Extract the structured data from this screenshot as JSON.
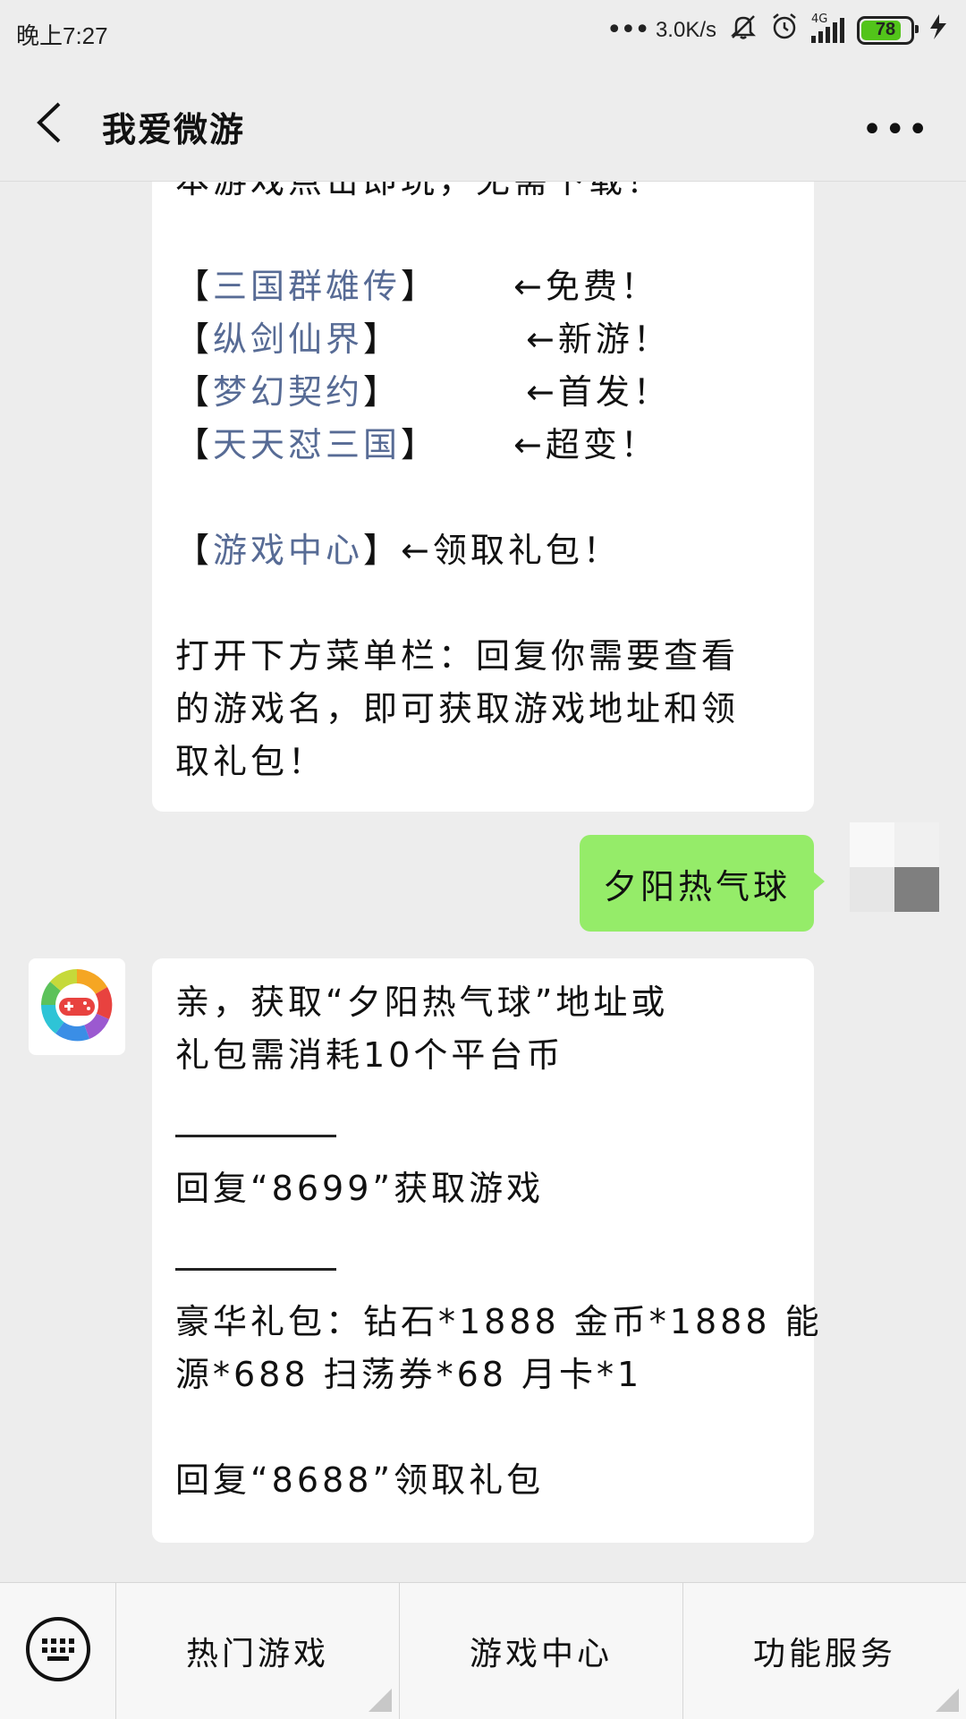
{
  "status_bar": {
    "time": "晚上7:27",
    "net_speed": "3.0K/s",
    "network_type": "4G",
    "battery_level": "78"
  },
  "header": {
    "title": "我爱微游"
  },
  "messages": {
    "first": {
      "cut_line": "本游戏点击即玩，无需下载！",
      "games": [
        {
          "open": "【",
          "name": "三国群雄传",
          "close": "】",
          "tag": "←免费！"
        },
        {
          "open": "【",
          "name": "纵剑仙界",
          "close": "】",
          "tag": "←新游！"
        },
        {
          "open": "【",
          "name": "梦幻契约",
          "close": "】",
          "tag": "←首发！"
        },
        {
          "open": "【",
          "name": "天天怼三国",
          "close": "】",
          "tag": "←超变！"
        }
      ],
      "center": {
        "open": "【",
        "name": "游戏中心",
        "close": "】",
        "tag": "←领取礼包！"
      },
      "instructions": [
        "打开下方菜单栏：回复你需要查看",
        "的游戏名，即可获取游戏地址和领",
        "取礼包！"
      ]
    },
    "user": {
      "text": "夕阳热气球"
    },
    "reply": {
      "line1": "亲，获取“夕阳热气球”地址或",
      "line2": "礼包需消耗10个平台币",
      "game_line": "回复“8699”获取游戏",
      "gift_line1": "豪华礼包：钻石*1888 金币*1888 能",
      "gift_line2": "源*688 扫荡券*68 月卡*1",
      "gift_reply": "回复“8688”领取礼包"
    }
  },
  "menu": {
    "items": [
      "热门游戏",
      "游戏中心",
      "功能服务"
    ]
  },
  "colors": {
    "link": "#576b95",
    "user_bubble": "#95ec69",
    "battery": "#52c41a"
  },
  "icons": [
    "back-arrow-icon",
    "more-icon",
    "keyboard-icon",
    "mute-bell-icon",
    "alarm-icon",
    "signal-icon",
    "charging-icon",
    "game-controller-icon"
  ]
}
